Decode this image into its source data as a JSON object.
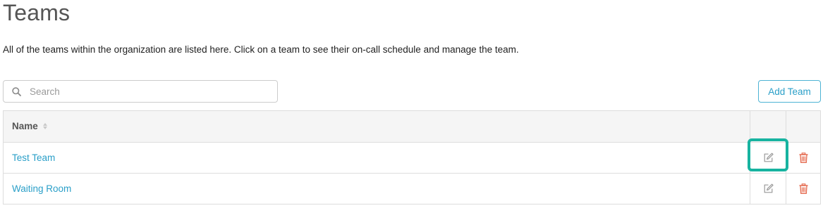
{
  "header": {
    "title": "Teams",
    "description": "All of the teams within the organization are listed here. Click on a team to see their on-call schedule and manage the team."
  },
  "search": {
    "placeholder": "Search",
    "value": ""
  },
  "toolbar": {
    "add_team_label": "Add Team"
  },
  "table": {
    "columns": [
      {
        "label": "Name",
        "sortable": true
      }
    ],
    "rows": [
      {
        "name": "Test Team"
      },
      {
        "name": "Waiting Room"
      }
    ]
  },
  "icons": {
    "search": "search-icon",
    "sort": "sort-icon",
    "edit": "edit-icon",
    "delete": "trash-icon"
  },
  "colors": {
    "link": "#2a9fc8",
    "delete": "#e4664a",
    "highlight": "#17b3a0",
    "header_bg": "#f5f5f5",
    "border": "#dddddd"
  }
}
